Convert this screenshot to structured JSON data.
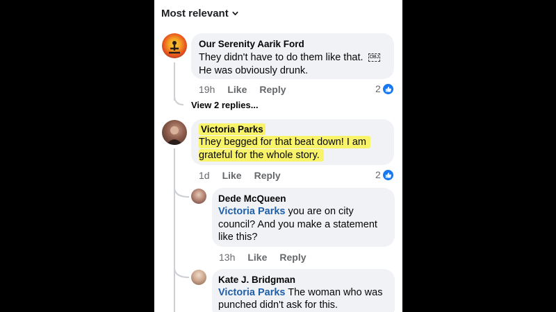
{
  "sort": {
    "label": "Most relevant"
  },
  "comments": [
    {
      "author": "Our Serenity Aarik Ford",
      "text_line1": "They didn't have to do them like that.",
      "text_line2": "He was obviously drunk.",
      "time": "19h",
      "like": "Like",
      "reply": "Reply",
      "reaction_count": "2",
      "view_replies": "View 2 replies..."
    },
    {
      "author": "Victoria Parks",
      "text_line1": "They begged for that beat down! I am",
      "text_line2": "grateful for the whole story.",
      "time": "1d",
      "like": "Like",
      "reply": "Reply",
      "reaction_count": "2"
    }
  ],
  "replies": [
    {
      "author": "Dede McQueen",
      "mention": "Victoria Parks",
      "text_line1": "you are on city",
      "text_line2": "council? And you make a statement",
      "text_line3": "like this?",
      "time": "13h",
      "like": "Like",
      "reply": "Reply"
    },
    {
      "author": "Kate J. Bridgman",
      "mention": "Victoria Parks",
      "text_line1": "The woman who was",
      "text_line2": "punched didn't ask for this."
    }
  ],
  "colors": {
    "like_blue": "#1877f2",
    "mention_blue": "#1f5fa8",
    "highlight": "#f9f36a",
    "bubble": "#f0f2f5"
  }
}
